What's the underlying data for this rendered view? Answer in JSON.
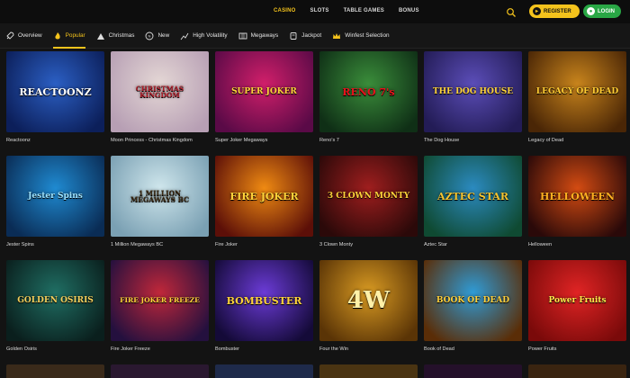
{
  "topnav": {
    "items": [
      {
        "label": "CASINO",
        "active": true
      },
      {
        "label": "SLOTS",
        "active": false
      },
      {
        "label": "TABLE GAMES",
        "active": false
      },
      {
        "label": "BONUS",
        "active": false
      }
    ],
    "register_label": "REGISTER",
    "login_label": "LOGIN",
    "accent_color": "#f4c31c",
    "login_color": "#29a745"
  },
  "categories": [
    {
      "label": "Overview",
      "icon": "rocket-icon",
      "active": false
    },
    {
      "label": "Popular",
      "icon": "flame-icon",
      "active": true
    },
    {
      "label": "Christmas",
      "icon": "snowy-mountain-icon",
      "active": false
    },
    {
      "label": "New",
      "icon": "new-badge-icon",
      "active": false
    },
    {
      "label": "High Volatility",
      "icon": "chart-icon",
      "active": false
    },
    {
      "label": "Megaways",
      "icon": "megaways-icon",
      "active": false
    },
    {
      "label": "Jackpot",
      "icon": "jackpot-icon",
      "active": false
    },
    {
      "label": "Winfest Selection",
      "icon": "crown-icon",
      "active": false
    }
  ],
  "games": [
    {
      "name": "Reactoonz",
      "logo": "REACTOONZ",
      "bg": [
        "#2b5fc4",
        "#0c1f5a"
      ],
      "color": "#ffffff"
    },
    {
      "name": "Moon Princess - Christmas Kingdom",
      "logo": "CHRISTMAS KINGDOM",
      "bg": [
        "#e4d7d5",
        "#b79fb4"
      ],
      "color": "#b21f2b"
    },
    {
      "name": "Super Joker Megaways",
      "logo": "SUPER JOKER",
      "bg": [
        "#d11f6a",
        "#5a0a47"
      ],
      "color": "#ffd33a"
    },
    {
      "name": "Reno's 7",
      "logo": "RENO 7's",
      "bg": [
        "#3a8d3a",
        "#0f2f16"
      ],
      "color": "#e7121b"
    },
    {
      "name": "The Dog House",
      "logo": "THE DOG HOUSE",
      "bg": [
        "#5b4db8",
        "#231c56"
      ],
      "color": "#ffd33a"
    },
    {
      "name": "Legacy of Dead",
      "logo": "LEGACY OF DEAD",
      "bg": [
        "#c8841c",
        "#4a2606"
      ],
      "color": "#ffcc33"
    },
    {
      "name": "Jester Spins",
      "logo": "Jester Spins",
      "bg": [
        "#1f8ad1",
        "#0a2c55"
      ],
      "color": "#9de3ff"
    },
    {
      "name": "1 Million Megaways BC",
      "logo": "1 MILLION MEGAWAYS BC",
      "bg": [
        "#cfe6ec",
        "#7aa0b3"
      ],
      "color": "#3b2a14"
    },
    {
      "name": "Fire Joker",
      "logo": "FIRE JOKER",
      "bg": [
        "#ef8a12",
        "#5c0f08"
      ],
      "color": "#ffd33a"
    },
    {
      "name": "3 Clown Monty",
      "logo": "3 CLOWN MONTY",
      "bg": [
        "#9f1e1e",
        "#2b0909"
      ],
      "color": "#ffd33a"
    },
    {
      "name": "Aztec Star",
      "logo": "AZTEC STAR",
      "bg": [
        "#2b8ac0",
        "#0f4a32"
      ],
      "color": "#f6c430"
    },
    {
      "name": "Helloween",
      "logo": "HELLOWEEN",
      "bg": [
        "#d34b12",
        "#2a0909"
      ],
      "color": "#ffb020"
    },
    {
      "name": "Golden Osiris",
      "logo": "GOLDEN OSIRIS",
      "bg": [
        "#1f6e63",
        "#0a1f1d"
      ],
      "color": "#f4cf5c"
    },
    {
      "name": "Fire Joker Freeze",
      "logo": "FIRE JOKER FREEZE",
      "bg": [
        "#c0273a",
        "#24103e"
      ],
      "color": "#ffd33a"
    },
    {
      "name": "Bombuster",
      "logo": "BOMBUSTER",
      "bg": [
        "#6b3bd6",
        "#140a38"
      ],
      "color": "#ffd33a"
    },
    {
      "name": "Four the Win",
      "logo": "4W",
      "bg": [
        "#d89a22",
        "#5a3406"
      ],
      "color": "#fff1a8"
    },
    {
      "name": "Book of Dead",
      "logo": "BOOK OF DEAD",
      "bg": [
        "#2f9bd6",
        "#5a2d07"
      ],
      "color": "#ffcf3a"
    },
    {
      "name": "Power Fruits",
      "logo": "Power Fruits",
      "bg": [
        "#e02424",
        "#7a0a0a"
      ],
      "color": "#ffe84a"
    }
  ],
  "next_row_colors": [
    "#3a2a1a",
    "#2a1830",
    "#1e2a4a",
    "#4a3412",
    "#24102a",
    "#3a2410"
  ]
}
